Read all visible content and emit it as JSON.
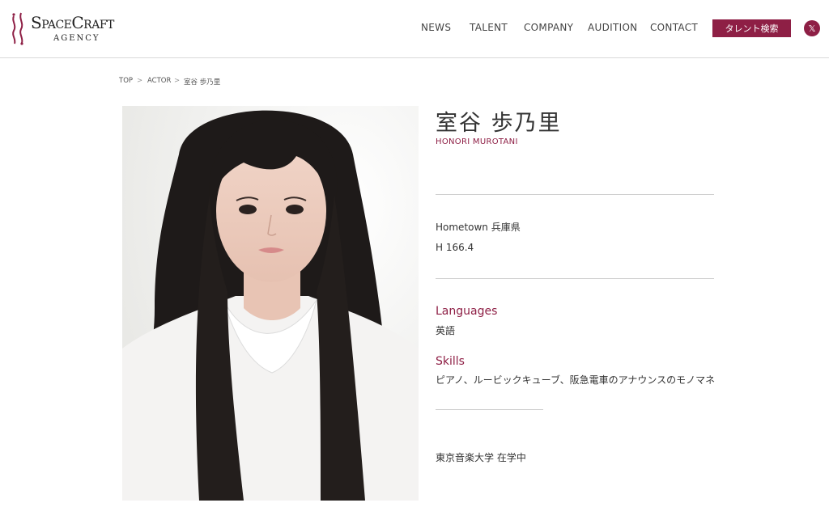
{
  "brand": {
    "logo_word": "SpaceCraft",
    "logo_sub": "AGENCY",
    "accent": "#8e1f45"
  },
  "nav": {
    "items": [
      "NEWS",
      "TALENT",
      "COMPANY",
      "AUDITION",
      "CONTACT"
    ],
    "search_label": "タレント検索",
    "x_icon": "x-logo-icon"
  },
  "breadcrumb": [
    "TOP",
    "ACTOR",
    "室谷 歩乃里"
  ],
  "profile": {
    "name_ja": "室谷 歩乃里",
    "name_en": "HONORI MUROTANI",
    "hometown_label": "Hometown",
    "hometown_value": "兵庫県",
    "height": "H 166.4",
    "languages_title": "Languages",
    "languages_value": "英語",
    "skills_title": "Skills",
    "skills_value": "ピアノ、ルービックキューブ、阪急電車のアナウンスのモノマネ",
    "note": "東京音楽大学 在学中"
  }
}
